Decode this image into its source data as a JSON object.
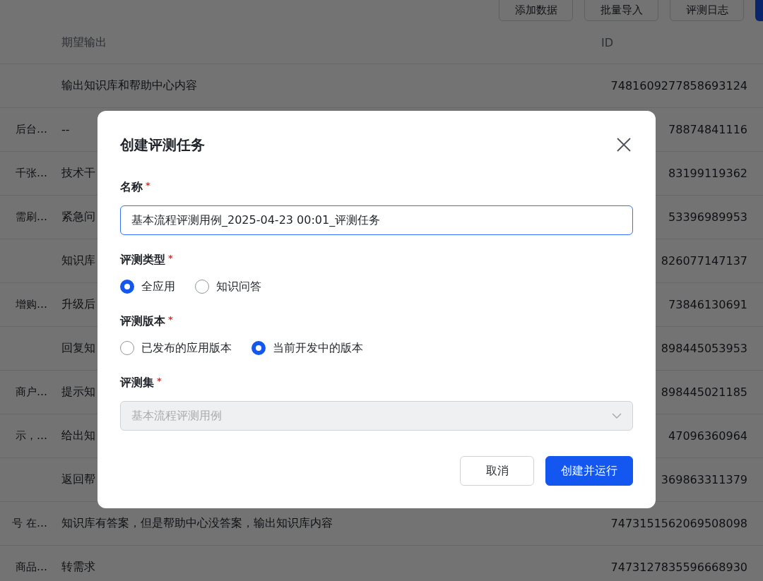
{
  "toolbar": {
    "buttons": [
      {
        "label": "添加数据"
      },
      {
        "label": "批量导入"
      },
      {
        "label": "评测日志"
      }
    ]
  },
  "table": {
    "columns": [
      "期望输出",
      "ID"
    ],
    "rows": [
      {
        "column_1": "",
        "expected_output": "输出知识库和帮助中心内容",
        "id": "7481609277858693124"
      },
      {
        "column_1": "后台…",
        "expected_output": "--",
        "id": "78874841116"
      },
      {
        "column_1": "千张…",
        "expected_output": "技术干",
        "id": "83199119362"
      },
      {
        "column_1": "需刷…",
        "expected_output": "紧急问",
        "id": "53396989953"
      },
      {
        "column_1": "",
        "expected_output": "知识库",
        "id": "826077147137"
      },
      {
        "column_1": "增购…",
        "expected_output": "升级后",
        "id": "73846130691"
      },
      {
        "column_1": "",
        "expected_output": "回复知",
        "id": "898445053953"
      },
      {
        "column_1": "商户…",
        "expected_output": "提示知",
        "id": "898445021185"
      },
      {
        "column_1": "示，…",
        "expected_output": "给出知",
        "id": "47096360964"
      },
      {
        "column_1": "",
        "expected_output": "返回帮",
        "id": "369863311379"
      },
      {
        "column_1": "号 在…",
        "expected_output": "知识库有答案，但是帮助中心没答案，输出知识库内容",
        "id": "7473151562069508098"
      },
      {
        "column_1": "商品…",
        "expected_output": "转需求",
        "id": "7473127835596668930"
      }
    ]
  },
  "dialog": {
    "title": "创建评测任务",
    "fields": [
      {
        "kind": "text",
        "label": "名称",
        "required_mark": "*",
        "value": "基本流程评测用例_2025-04-23 00:01_评测任务",
        "focused": true
      },
      {
        "kind": "radio",
        "label": "评测类型",
        "required_mark": "*",
        "options": [
          {
            "label": "全应用",
            "selected": true
          },
          {
            "label": "知识问答",
            "selected": false
          }
        ]
      },
      {
        "kind": "radio",
        "label": "评测版本",
        "required_mark": "*",
        "options": [
          {
            "label": "已发布的应用版本",
            "selected": false
          },
          {
            "label": "当前开发中的版本",
            "selected": true
          }
        ]
      },
      {
        "kind": "select",
        "label": "评测集",
        "required_mark": "*",
        "value": "基本流程评测用例",
        "disabled": true
      }
    ],
    "buttons": [
      {
        "label": "取消",
        "kind": "secondary"
      },
      {
        "label": "创建并运行",
        "kind": "primary"
      }
    ]
  }
}
